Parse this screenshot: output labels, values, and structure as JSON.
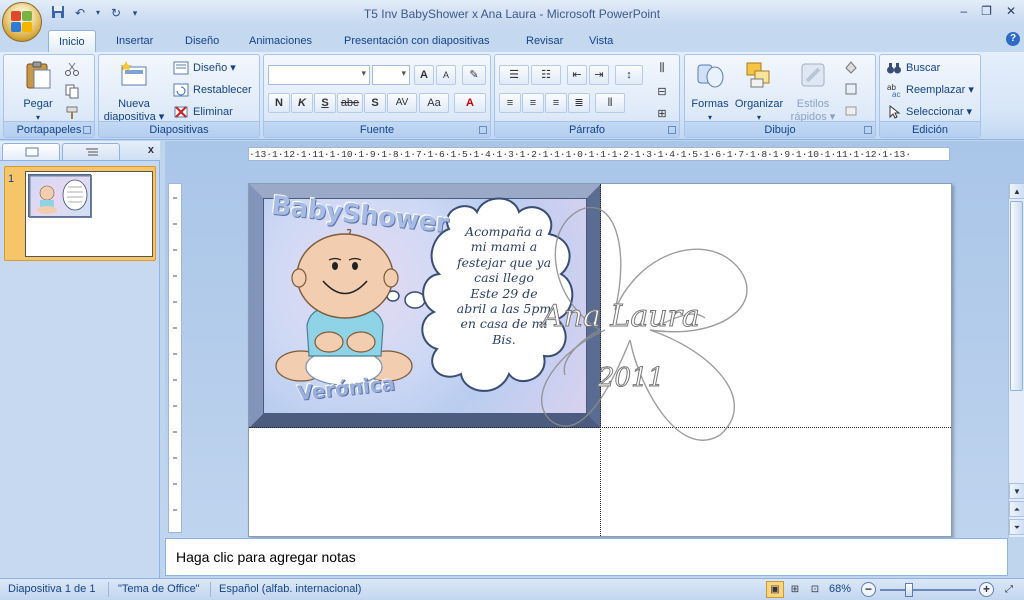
{
  "window": {
    "title": "T5 Inv BabyShower x Ana Laura - Microsoft PowerPoint",
    "controls": [
      "–",
      "❐",
      "✕"
    ]
  },
  "tabs": [
    "Inicio",
    "Insertar",
    "Diseño",
    "Animaciones",
    "Presentación con diapositivas",
    "Revisar",
    "Vista"
  ],
  "ribbon": {
    "portapapeles": {
      "label": "Portapapeles",
      "paste": "Pegar"
    },
    "diapositivas": {
      "label": "Diapositivas",
      "new_slide_1": "Nueva",
      "new_slide_2": "diapositiva ▾",
      "layout": "Diseño ▾",
      "reset": "Restablecer",
      "delete": "Eliminar"
    },
    "fuente": {
      "label": "Fuente",
      "bold": "N",
      "italic": "K",
      "underline": "S",
      "strike": "abe",
      "shadow": "S",
      "spacing": "AV",
      "case": "Aa",
      "color": "A",
      "grow": "A",
      "shrink": "A"
    },
    "parrafo": {
      "label": "Párrafo"
    },
    "dibujo": {
      "label": "Dibujo",
      "shapes": "Formas",
      "arrange": "Organizar",
      "styles_1": "Estilos",
      "styles_2": "rápidos ▾"
    },
    "edicion": {
      "label": "Edición",
      "find": "Buscar",
      "replace": "Reemplazar ▾",
      "select": "Seleccionar ▾"
    }
  },
  "slides_pane": {
    "close": "x",
    "thumb_number": "1"
  },
  "ruler": {
    "horizontal": "·13·1·12·1·11·1·10·1·9·1·8·1·7·1·6·1·5·1·4·1·3·1·2·1·1·1·0·1·1·1·2·1·3·1·4·1·5·1·6·1·7·1·8·1·9·1·10·1·11·1·12·1·13·"
  },
  "slide": {
    "card_title": "BabyShower",
    "card_name": "Verónica",
    "cloud_lines": [
      "Acompaña a",
      "mi mami  a",
      "festejar que ya",
      "casi llego",
      "Este 29 de",
      "abril a las 5pm",
      "en casa de mi",
      "Bis."
    ],
    "watermark_1": "Ana Laura",
    "watermark_2": "2011"
  },
  "notes": {
    "placeholder": "Haga clic para agregar notas"
  },
  "status": {
    "slide_info": "Diapositiva 1 de 1",
    "theme": "\"Tema de Office\"",
    "language": "Español (alfab. internacional)",
    "zoom": "68%"
  },
  "colors": {
    "ribbon_text": "#15428b",
    "frame": "#6b7fa6"
  }
}
